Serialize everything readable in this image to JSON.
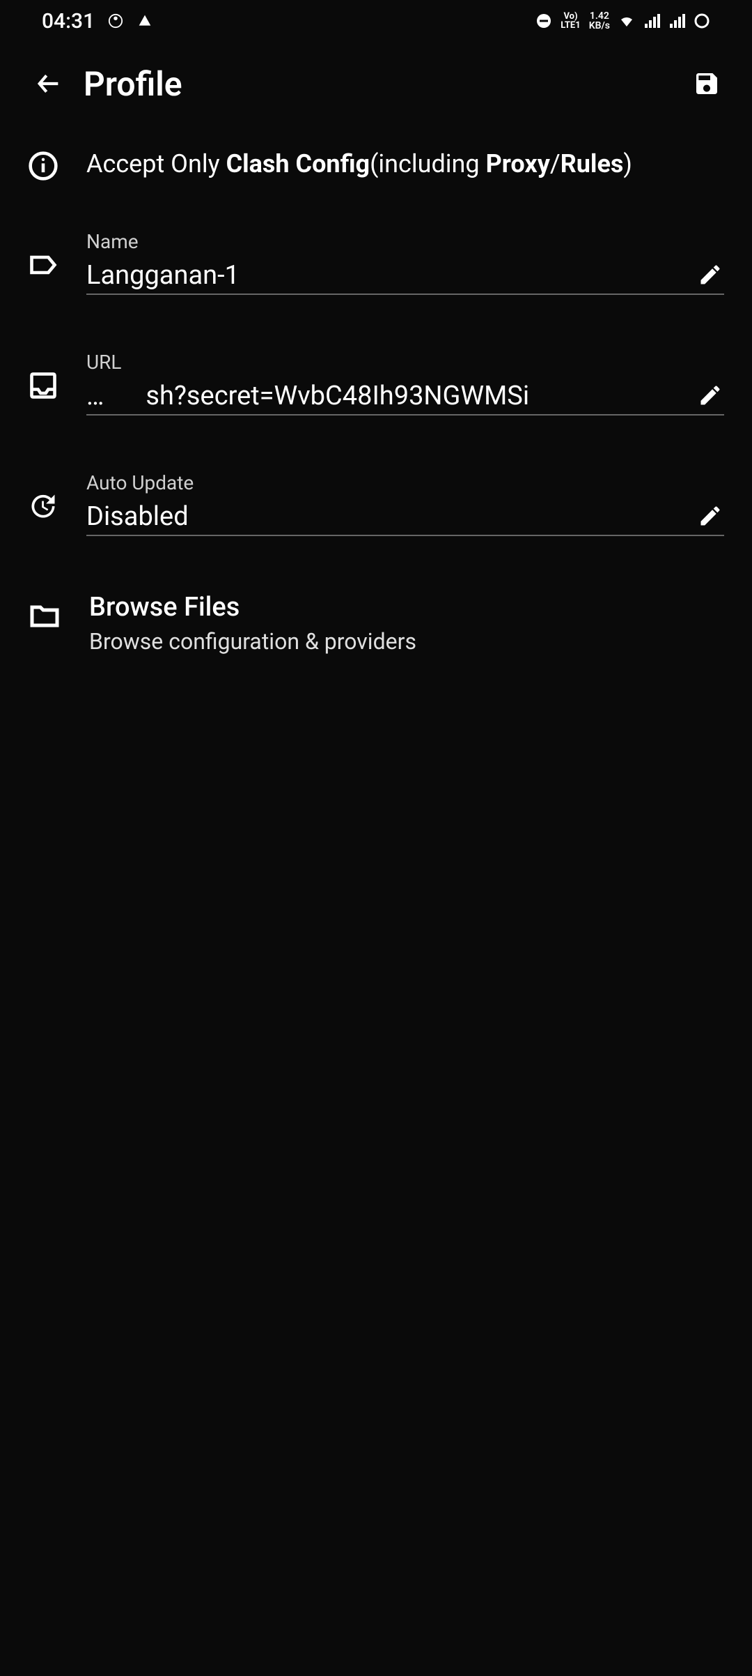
{
  "status": {
    "time": "04:31",
    "net_speed_top": "1.42",
    "net_speed_bottom": "KB/s",
    "lte_top": "Vo)",
    "lte_bottom": "LTE1"
  },
  "appbar": {
    "title": "Profile"
  },
  "info": {
    "prefix": "Accept Only ",
    "bold1": "Clash Config",
    "middle": "(including ",
    "bold2": "Proxy",
    "slash": "/",
    "bold3": "Rules",
    "suffix": ")"
  },
  "fields": {
    "name": {
      "label": "Name",
      "value": "Langganan-1"
    },
    "url": {
      "label": "URL",
      "ellipsis": "…",
      "value": "sh?secret=WvbC48Ih93NGWMSi"
    },
    "autoupdate": {
      "label": "Auto Update",
      "value": "Disabled"
    }
  },
  "browse": {
    "title": "Browse Files",
    "subtitle": "Browse configuration & providers"
  }
}
